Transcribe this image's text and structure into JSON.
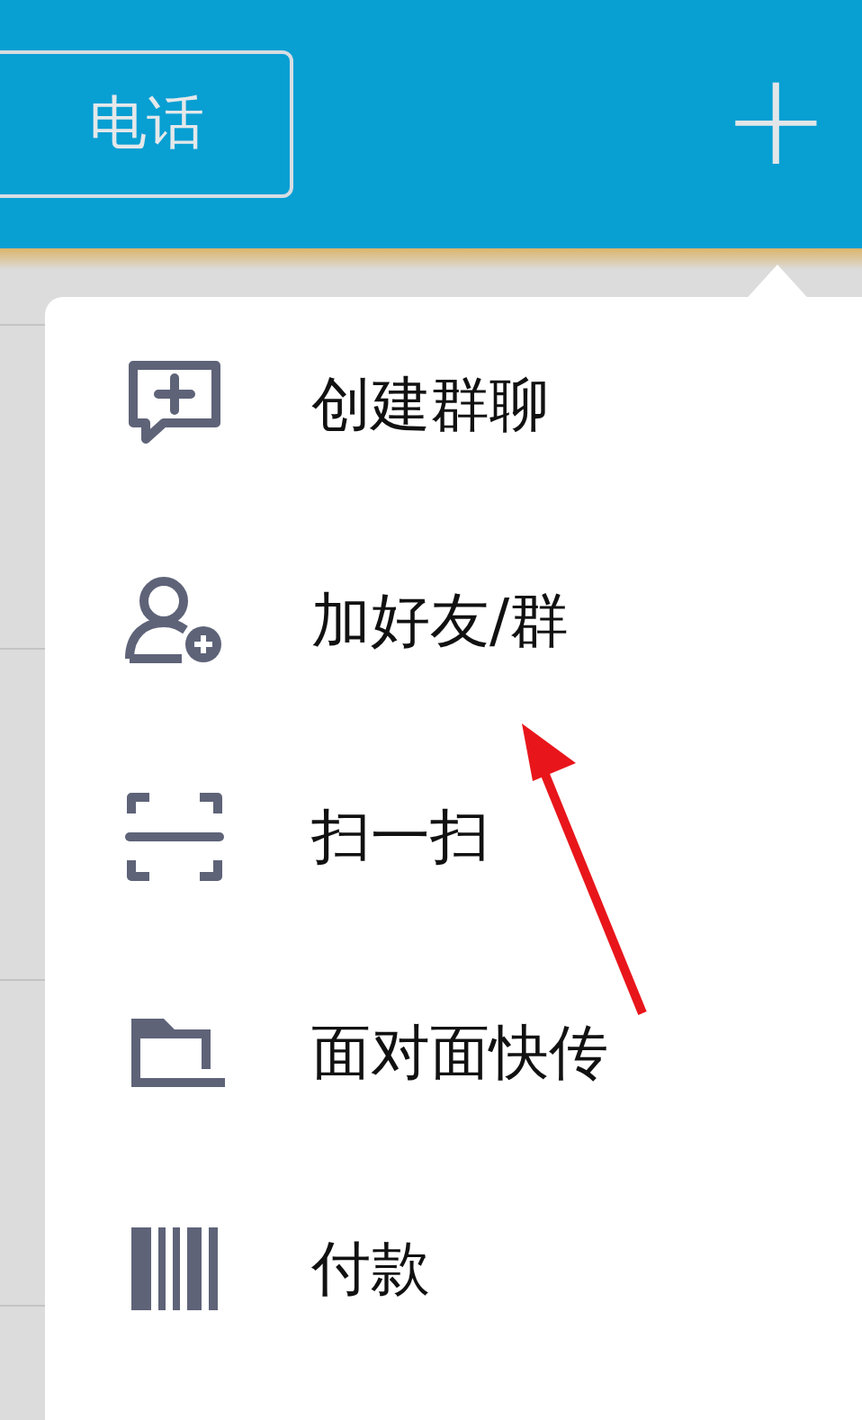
{
  "header": {
    "phone_button": "电话",
    "add_button": "+"
  },
  "menu": {
    "items": [
      {
        "kind": "group-chat",
        "label": "创建群聊"
      },
      {
        "kind": "add-friend",
        "label": "加好友/群"
      },
      {
        "kind": "scan",
        "label": "扫一扫"
      },
      {
        "kind": "transfer",
        "label": "面对面快传"
      },
      {
        "kind": "pay",
        "label": "付款"
      }
    ]
  }
}
